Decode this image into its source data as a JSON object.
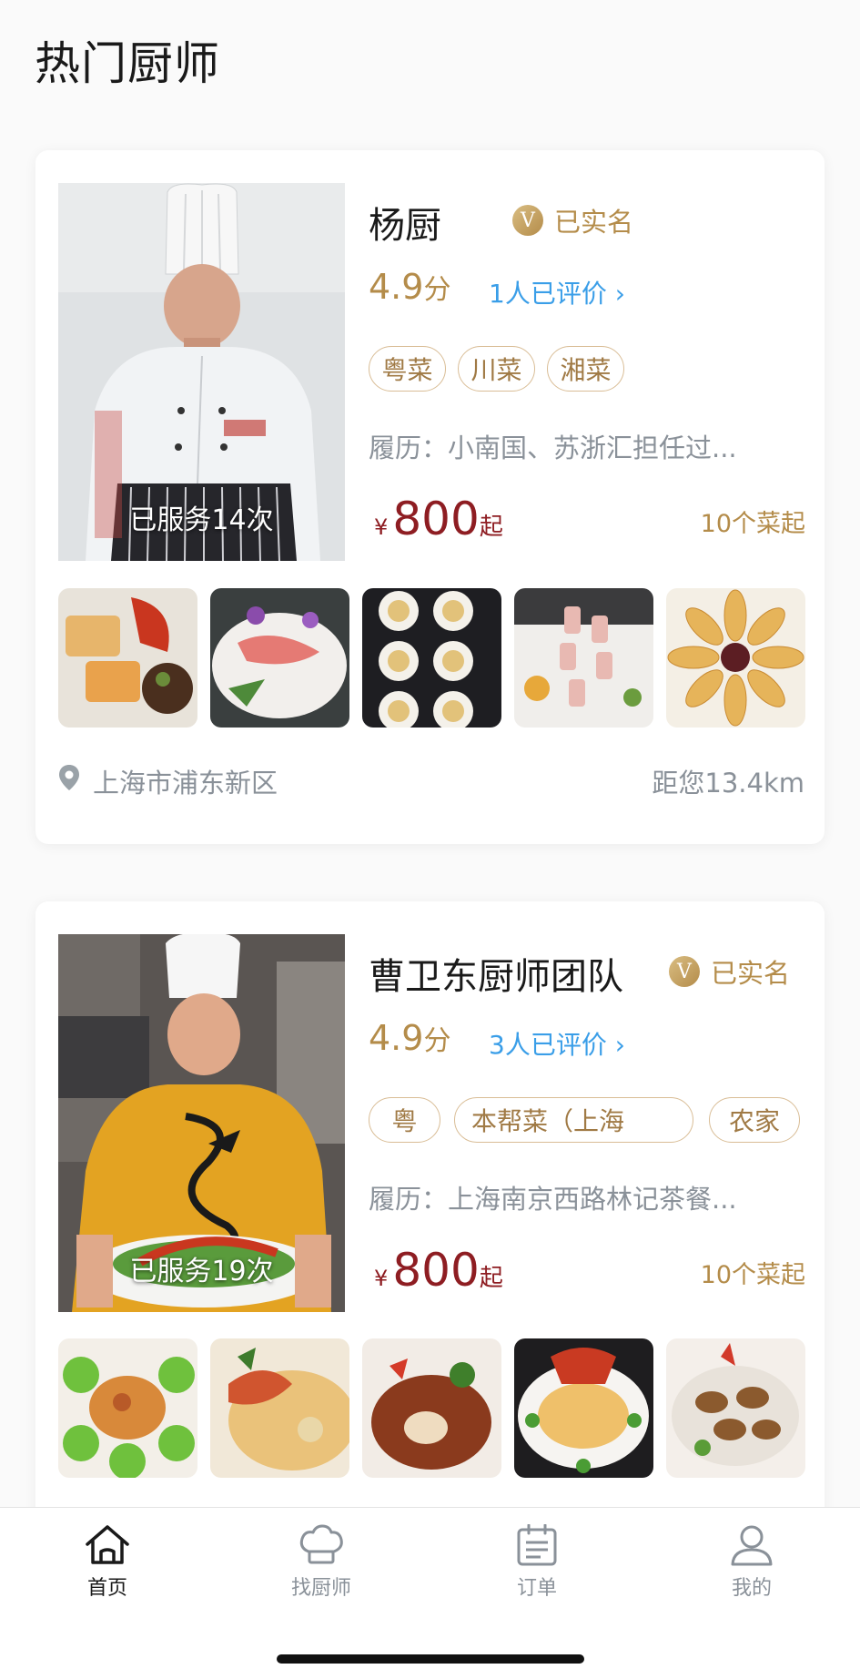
{
  "page": {
    "title": "热门厨师"
  },
  "chefs": [
    {
      "name": "杨厨",
      "verified_label": "已实名",
      "verified_badge": "V",
      "score": "4.9",
      "score_unit": "分",
      "reviews": "1人已评价 ›",
      "tags": [
        "粤菜",
        "川菜",
        "湘菜"
      ],
      "resume": "履历：小南国、苏浙汇担任过...",
      "currency": "¥",
      "price": "800",
      "price_suffix": "起",
      "min_dishes": "10个菜起",
      "served": "已服务14次",
      "location": "上海市浦东新区",
      "distance": "距您13.4km"
    },
    {
      "name": "曹卫东厨师团队",
      "verified_label": "已实名",
      "verified_badge": "V",
      "score": "4.9",
      "score_unit": "分",
      "reviews": "3人已评价 ›",
      "tags": [
        "粤",
        "本帮菜（上海",
        "农家"
      ],
      "resume": "履历：上海南京西路林记茶餐...",
      "currency": "¥",
      "price": "800",
      "price_suffix": "起",
      "min_dishes": "10个菜起",
      "served": "已服务19次"
    }
  ],
  "tabbar": {
    "items": [
      {
        "label": "首页",
        "icon": "home-icon",
        "active": true
      },
      {
        "label": "找厨师",
        "icon": "chef-hat-icon",
        "active": false
      },
      {
        "label": "订单",
        "icon": "order-list-icon",
        "active": false
      },
      {
        "label": "我的",
        "icon": "user-icon",
        "active": false
      }
    ]
  },
  "colors": {
    "accent_gold": "#b48c4a",
    "price_red": "#8e1d22",
    "link_blue": "#3a9ee8",
    "muted_gray": "#8a9199"
  }
}
